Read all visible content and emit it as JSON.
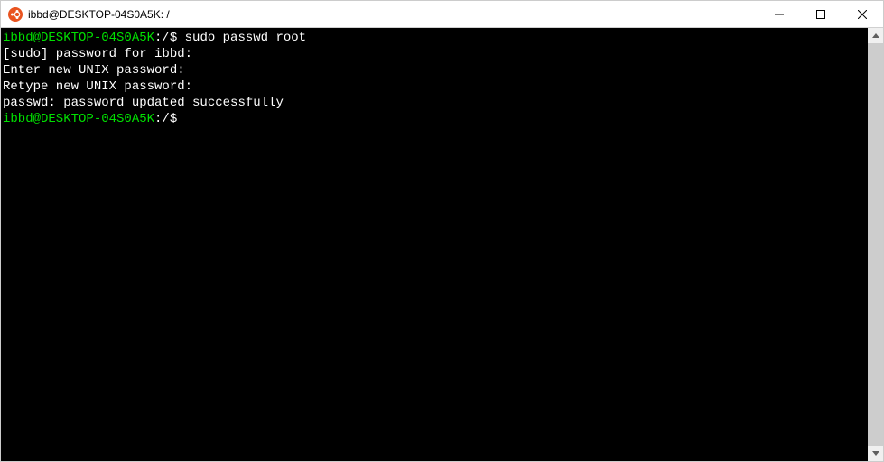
{
  "window": {
    "title": "ibbd@DESKTOP-04S0A5K: /"
  },
  "terminal": {
    "lines": [
      {
        "prompt": "ibbd@DESKTOP-04S0A5K",
        "path": ":/$ ",
        "command": "sudo passwd root"
      },
      {
        "output": "[sudo] password for ibbd:"
      },
      {
        "output": "Enter new UNIX password:"
      },
      {
        "output": "Retype new UNIX password:"
      },
      {
        "output": "passwd: password updated successfully"
      },
      {
        "prompt": "ibbd@DESKTOP-04S0A5K",
        "path": ":/$ ",
        "command": ""
      }
    ]
  }
}
